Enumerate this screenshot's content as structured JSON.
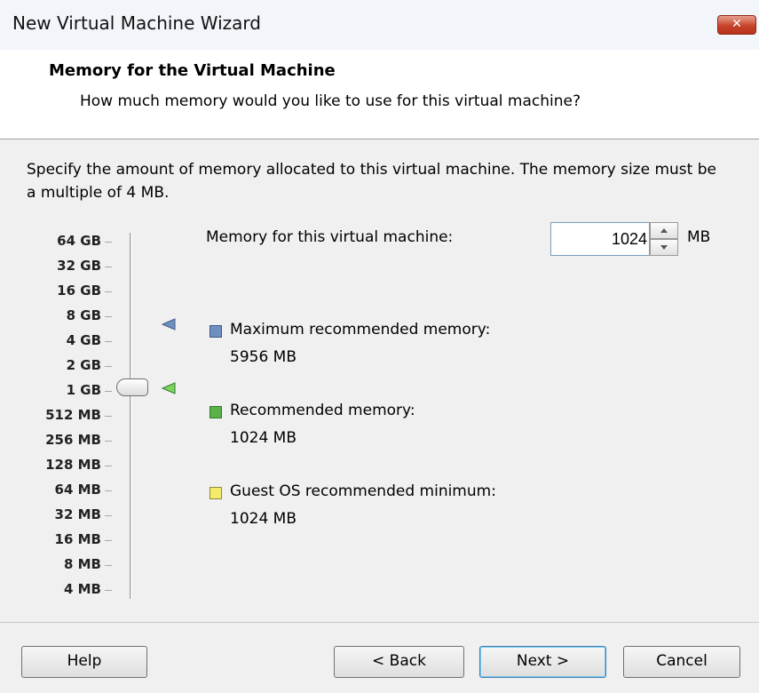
{
  "window": {
    "title": "New Virtual Machine Wizard",
    "close_glyph": "✕"
  },
  "header": {
    "title": "Memory for the Virtual Machine",
    "subtitle": "How much memory would you like to use for this virtual machine?"
  },
  "description": "Specify the amount of memory allocated to this virtual machine. The memory size must be a multiple of 4 MB.",
  "scale": {
    "labels": [
      "64 GB",
      "32 GB",
      "16 GB",
      "8 GB",
      "4 GB",
      "2 GB",
      "1 GB",
      "512 MB",
      "256 MB",
      "128 MB",
      "64 MB",
      "32 MB",
      "16 MB",
      "8 MB",
      "4 MB"
    ],
    "selected": "1 GB"
  },
  "memory": {
    "label": "Memory for this virtual machine:",
    "value": "1024",
    "unit": "MB"
  },
  "legend": {
    "max": {
      "label": "Maximum recommended memory:",
      "value": "5956 MB",
      "color": "#6f8fbf"
    },
    "recommended": {
      "label": "Recommended memory:",
      "value": "1024 MB",
      "color": "#5bb04a"
    },
    "minimum": {
      "label": "Guest OS recommended minimum:",
      "value": "1024 MB",
      "color": "#f5ea6a"
    }
  },
  "buttons": {
    "help": "Help",
    "back": "< Back",
    "next": "Next >",
    "cancel": "Cancel"
  }
}
